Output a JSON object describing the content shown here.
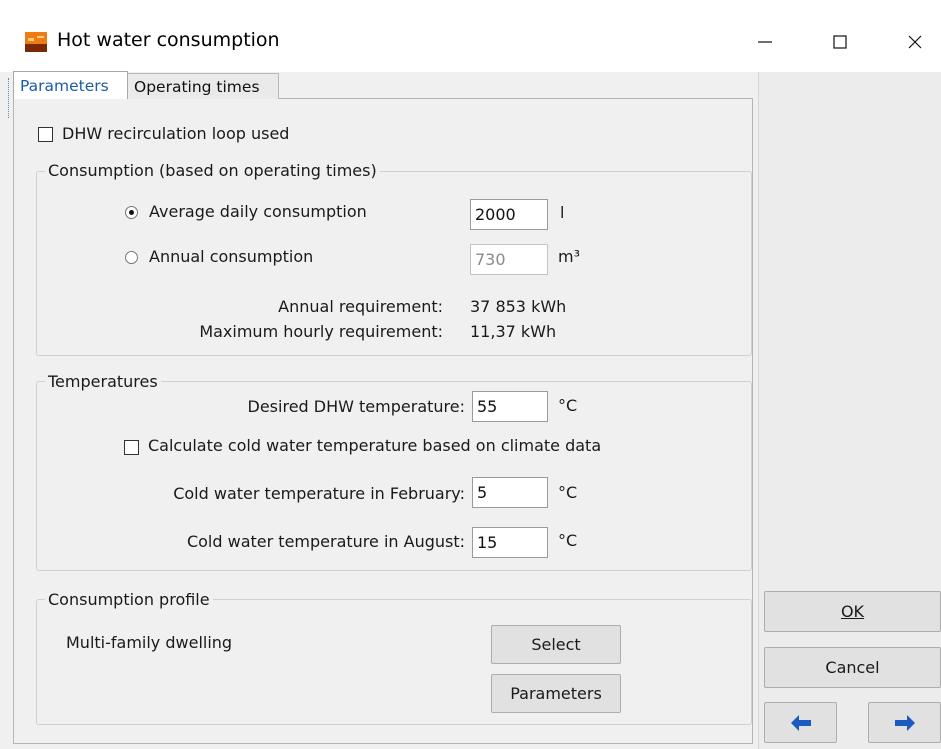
{
  "window": {
    "title": "Hot water consumption",
    "minimize_glyph": "—",
    "maximize_glyph": "☐",
    "close_glyph": "✕"
  },
  "tabs": [
    {
      "label": "Parameters",
      "active": true
    },
    {
      "label": "Operating times",
      "active": false
    }
  ],
  "recirculation": {
    "label": "DHW recirculation loop used",
    "checked": false
  },
  "consumption_group": {
    "title": "Consumption (based on operating times)",
    "average_daily": {
      "label": "Average daily consumption",
      "value": "2000",
      "unit": "l",
      "selected": true
    },
    "annual": {
      "label": "Annual consumption",
      "value": "730",
      "unit": "m³",
      "selected": false
    },
    "annual_requirement": {
      "label": "Annual requirement:",
      "value": "37 853 kWh"
    },
    "max_hourly_requirement": {
      "label": "Maximum hourly requirement:",
      "value": "11,37 kWh"
    }
  },
  "temperatures_group": {
    "title": "Temperatures",
    "desired_dhw": {
      "label": "Desired DHW temperature:",
      "value": "55",
      "unit": "°C"
    },
    "calc_cold_water": {
      "label": "Calculate cold water temperature based on climate data",
      "checked": false
    },
    "cold_feb": {
      "label": "Cold water temperature in February:",
      "value": "5",
      "unit": "°C"
    },
    "cold_aug": {
      "label": "Cold water temperature in August:",
      "value": "15",
      "unit": "°C"
    }
  },
  "profile_group": {
    "title": "Consumption profile",
    "profile_name": "Multi-family dwelling",
    "select_label": "Select",
    "parameters_label": "Parameters"
  },
  "side_buttons": {
    "ok_label": "OK",
    "cancel_label": "Cancel",
    "back_glyph": "🡐",
    "forward_glyph": "🡒"
  },
  "colors": {
    "active_tab_text": "#1e5aa8",
    "arrow_blue": "#1b5bbf",
    "app_icon_orange": "#f07a14"
  }
}
